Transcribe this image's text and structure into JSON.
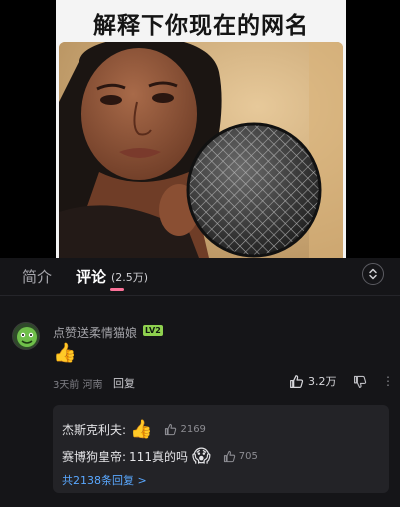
{
  "meme": {
    "title": "解释下你现在的网名"
  },
  "tabs": {
    "intro": "简介",
    "comments": "评论",
    "comment_count": "(2.5万)"
  },
  "comment": {
    "username": "点赞送柔情猫娘",
    "level": "LV2",
    "body": "👍",
    "time_location": "3天前 河南",
    "reply_label": "回复",
    "likes": "3.2万"
  },
  "replies": [
    {
      "author": "杰斯克利夫:",
      "emoji": "👍",
      "likes": "2169"
    },
    {
      "author": "赛博狗皇帝:",
      "text": "111真的吗",
      "emoji": "😱",
      "likes": "705"
    }
  ],
  "replies_total": "共2138条回复 >",
  "colors": {
    "accent_pink": "#fb7299",
    "link_blue": "#5aa8ff",
    "level_green": "#8fd14f"
  }
}
